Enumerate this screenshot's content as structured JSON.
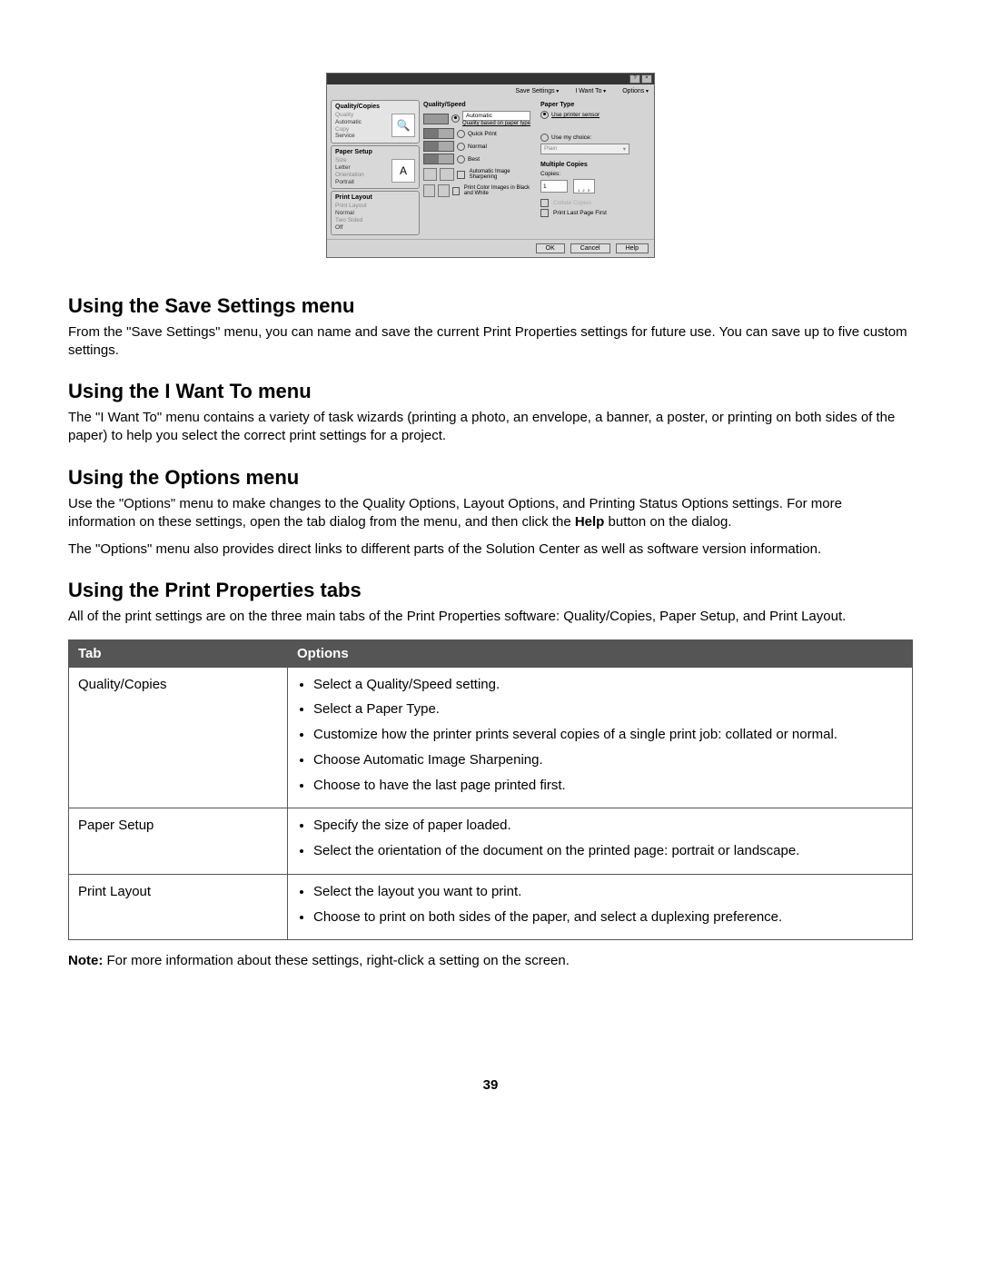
{
  "dialog": {
    "top_menus": {
      "save": "Save Settings",
      "iwant": "I Want To",
      "options": "Options"
    },
    "left": {
      "quality": {
        "title": "Quality/Copies",
        "l1": "Quality",
        "l2": "Automatic",
        "l3": "Copy",
        "l4": "Service"
      },
      "paper": {
        "title": "Paper Setup",
        "l1": "Size",
        "l2": "Letter",
        "l3": "Orientation",
        "l4": "Portrait",
        "icon": "A"
      },
      "layout": {
        "title": "Print Layout",
        "l1": "Print Layout",
        "l2": "Normal",
        "l3": "Two Sided",
        "l4": "Off"
      }
    },
    "mid": {
      "title": "Quality/Speed",
      "opt_auto": "Automatic",
      "opt_auto_sub": "Quality based on paper type",
      "opt_quick": "Quick Print",
      "opt_normal": "Normal",
      "opt_best": "Best",
      "opt_sharp": "Automatic Image Sharpening",
      "opt_bw": "Print Color Images in Black and White"
    },
    "right": {
      "pt_title": "Paper Type",
      "pt_sensor": "Use printer sensor",
      "pt_choice": "Use my choice:",
      "pt_select": "Plain",
      "mc_title": "Multiple Copies",
      "mc_copies": "Copies:",
      "mc_val": "1",
      "mc_collate": "Collate Copies",
      "mc_last": "Print Last Page First"
    },
    "buttons": {
      "ok": "OK",
      "cancel": "Cancel",
      "help": "Help"
    }
  },
  "sections": {
    "s1": {
      "h": "Using the Save Settings menu",
      "p": "From the \"Save Settings\" menu, you can name and save the current Print Properties settings for future use. You can save up to five custom settings."
    },
    "s2": {
      "h": "Using the I Want To menu",
      "p": "The \"I Want To\" menu contains a variety of task wizards (printing a photo, an envelope, a banner, a poster, or printing on both sides of the paper) to help you select the correct print settings for a project."
    },
    "s3": {
      "h": "Using the Options menu",
      "p1a": "Use the \"Options\" menu to make changes to the Quality Options, Layout Options, and Printing Status Options settings. For more information on these settings, open the tab dialog from the menu, and then click the ",
      "p1b": "Help",
      "p1c": " button on the dialog.",
      "p2": "The \"Options\" menu also provides direct links to different parts of the Solution Center as well as software version information."
    },
    "s4": {
      "h": "Using the Print Properties tabs",
      "p": "All of the print settings are on the three main tabs of the Print Properties software: Quality/Copies, Paper Setup, and Print Layout."
    }
  },
  "table": {
    "th1": "Tab",
    "th2": "Options",
    "r1": {
      "tab": "Quality/Copies",
      "o1": "Select a Quality/Speed setting.",
      "o2": "Select a Paper Type.",
      "o3": "Customize how the printer prints several copies of a single print job: collated or normal.",
      "o4": "Choose Automatic Image Sharpening.",
      "o5": "Choose to have the last page printed first."
    },
    "r2": {
      "tab": "Paper Setup",
      "o1": "Specify the size of paper loaded.",
      "o2": "Select the orientation of the document on the printed page: portrait or landscape."
    },
    "r3": {
      "tab": "Print Layout",
      "o1": "Select the layout you want to print.",
      "o2": "Choose to print on both sides of the paper, and select a duplexing preference."
    }
  },
  "note": {
    "label": "Note:",
    "text": " For more information about these settings, right-click a setting on the screen."
  },
  "page_number": "39"
}
